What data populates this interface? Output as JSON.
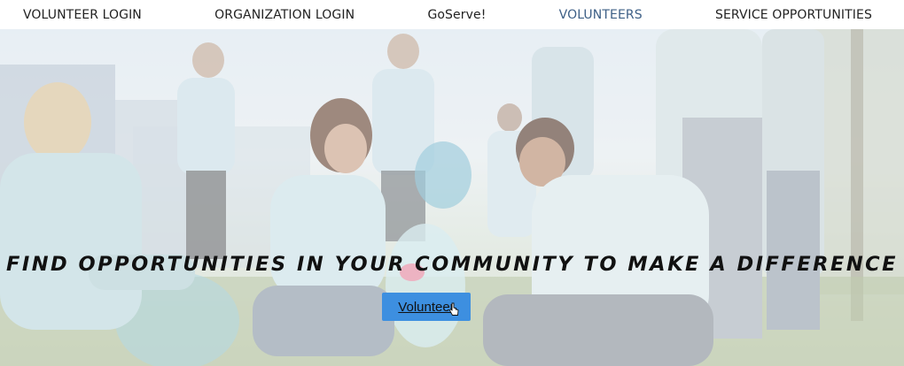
{
  "nav": {
    "items": [
      {
        "label": "VOLUNTEER LOGIN",
        "active": false
      },
      {
        "label": "ORGANIZATION LOGIN",
        "active": false
      },
      {
        "label": "GoServe!",
        "active": false
      },
      {
        "label": "VOLUNTEERS",
        "active": true
      },
      {
        "label": "SERVICE OPPORTUNITIES",
        "active": false
      }
    ]
  },
  "hero": {
    "headline": "FIND OPPORTUNITIES IN YOUR COMMUNITY TO MAKE A DIFFERENCE",
    "cta_label": "Volunteer"
  },
  "colors": {
    "nav_active": "#3d5f86",
    "cta_bg": "#3d8fe0",
    "text": "#111111"
  },
  "icons": {
    "cursor": "hand-pointer-icon"
  }
}
